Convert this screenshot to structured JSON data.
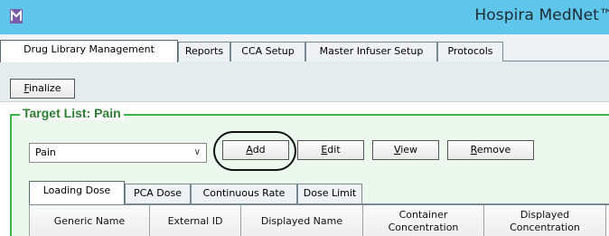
{
  "app": {
    "title": "Hospira MedNet™",
    "icon": "app-logo-icon",
    "accent": "#5fc5ea"
  },
  "tabs": [
    {
      "label": "Drug Library Management",
      "active": true
    },
    {
      "label": "Reports"
    },
    {
      "label": "CCA Setup"
    },
    {
      "label": "Master Infuser Setup"
    },
    {
      "label": "Protocols"
    }
  ],
  "toolbar": {
    "finalize_first": "F",
    "finalize_rest": "inalize"
  },
  "target_list": {
    "title": "Target List: Pain",
    "selected": "Pain",
    "add_first": "A",
    "add_rest": "dd",
    "edit_first": "E",
    "edit_rest": "dit",
    "view_first": "V",
    "view_rest": "iew",
    "remove_first": "R",
    "remove_rest": "emove"
  },
  "sub_tabs": [
    {
      "label": "Loading Dose",
      "active": true
    },
    {
      "label": "PCA Dose"
    },
    {
      "label": "Continuous Rate"
    },
    {
      "label": "Dose Limit"
    }
  ],
  "columns": [
    "Generic Name",
    "External ID",
    "Displayed Name",
    "Container Concentration",
    "Displayed Concentration"
  ]
}
